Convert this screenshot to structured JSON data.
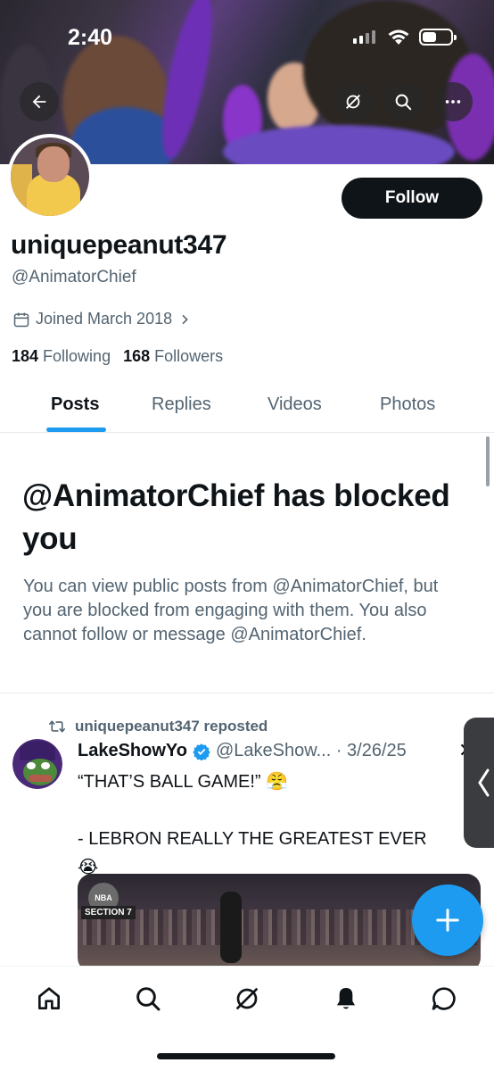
{
  "status_bar": {
    "time": "2:40"
  },
  "profile": {
    "display_name": "uniquepeanut347",
    "handle": "@AnimatorChief",
    "joined": "Joined March 2018",
    "following_count": "184",
    "following_label": "Following",
    "followers_count": "168",
    "followers_label": "Followers",
    "follow_button": "Follow"
  },
  "tabs": [
    {
      "label": "Posts",
      "active": true
    },
    {
      "label": "Replies",
      "active": false
    },
    {
      "label": "Videos",
      "active": false
    },
    {
      "label": "Photos",
      "active": false
    }
  ],
  "blocked": {
    "title": "@AnimatorChief has blocked you",
    "description": "You can view public posts from @AnimatorChief, but you are blocked from engaging with them. You also cannot follow or message @AnimatorChief."
  },
  "post": {
    "repost_label": "uniquepeanut347 reposted",
    "author_name": "LakeShowYo",
    "author_handle_date": "@LakeShow... · 3/26/25",
    "text": "“THAT’S BALL GAME!” 😤\n\n- LEBRON REALLY THE GREATEST EVER 😭\n🐐",
    "media_logo": "NBA",
    "media_section": "SECTION 7"
  },
  "icons": {
    "back": "arrow-left-icon",
    "grok": "grok-icon",
    "search": "search-icon",
    "more": "more-icon",
    "nav_home": "home-icon",
    "nav_search": "search-icon",
    "nav_grok": "grok-icon",
    "nav_notifications": "bell-icon",
    "nav_messages": "message-icon",
    "compose": "plus-icon"
  },
  "colors": {
    "accent": "#1d9bf0",
    "text": "#0f1419",
    "muted": "#536471"
  }
}
